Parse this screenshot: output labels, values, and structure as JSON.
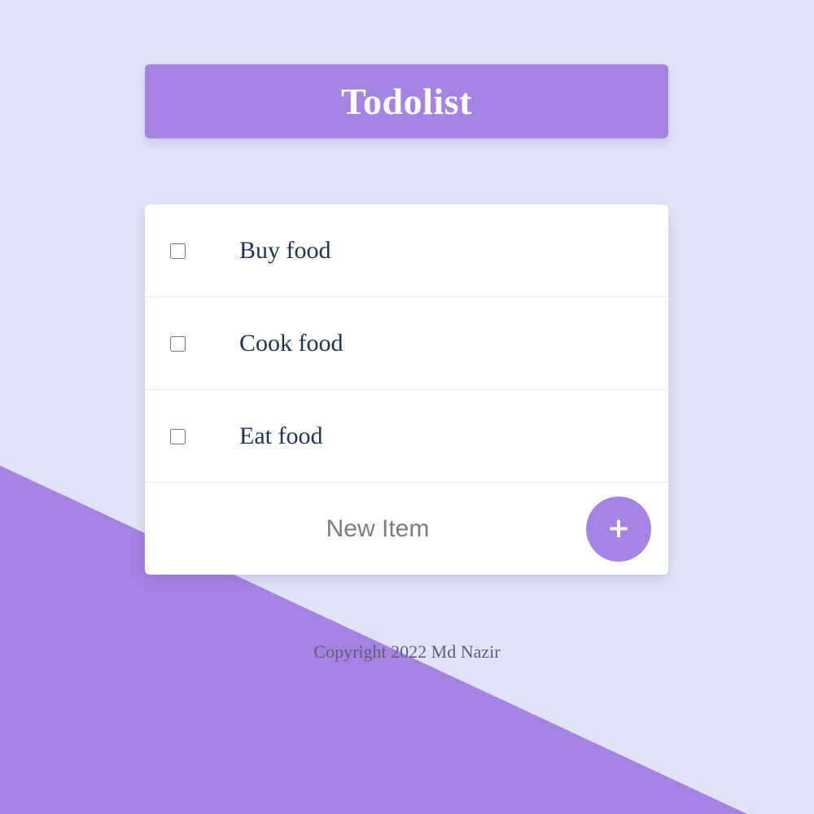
{
  "colors": {
    "background": "#E1E4F9",
    "accent": "#A683E2",
    "card": "#FFFFFF",
    "item_text": "#1C3556",
    "footer_text": "#5E5E73"
  },
  "header": {
    "title": "Todolist"
  },
  "todo": {
    "items": [
      {
        "label": "Buy food",
        "checked": false
      },
      {
        "label": "Cook food",
        "checked": false
      },
      {
        "label": "Eat food",
        "checked": false
      }
    ]
  },
  "new_item": {
    "value": "",
    "placeholder": "New Item",
    "add_icon": "plus-icon",
    "add_symbol": "+"
  },
  "footer": {
    "copyright": "Copyright 2022 Md Nazir"
  }
}
